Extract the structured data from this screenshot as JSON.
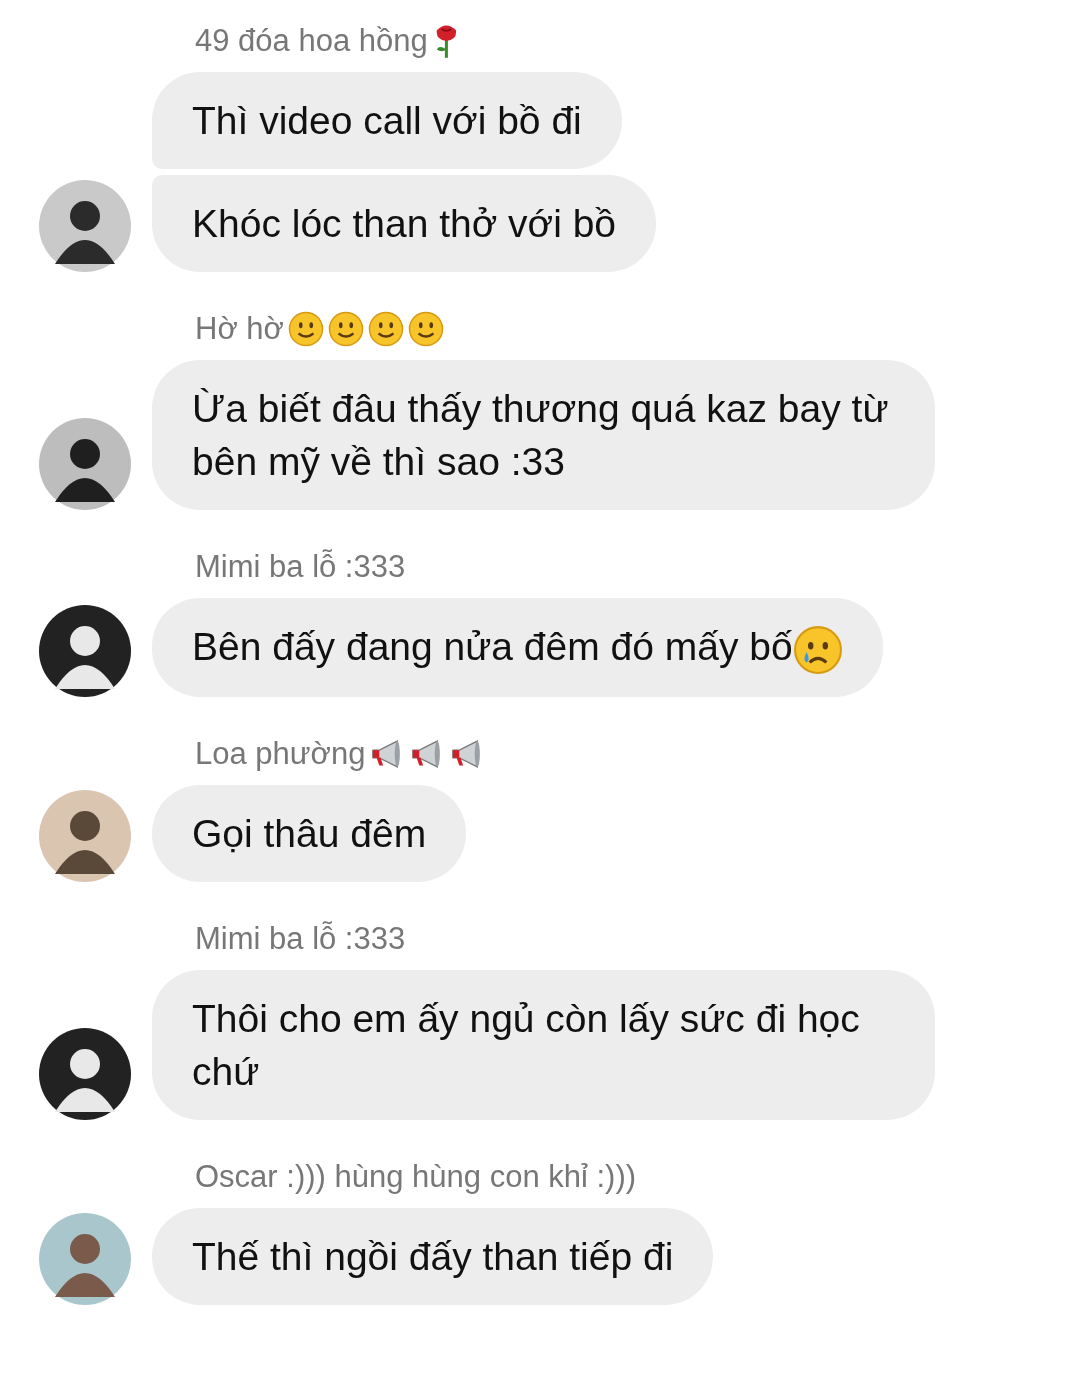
{
  "groups": [
    {
      "sender": {
        "name": "49 đóa hoa hồng",
        "emoji": [
          {
            "kind": "rose"
          }
        ]
      },
      "messages": [
        {
          "text": "Thì video call với bồ đi"
        },
        {
          "text": "Khóc lóc than thở với bồ"
        }
      ]
    },
    {
      "sender": {
        "name": "Hờ hờ",
        "emoji": [
          {
            "kind": "smile"
          },
          {
            "kind": "smile"
          },
          {
            "kind": "smile"
          },
          {
            "kind": "smile"
          }
        ]
      },
      "messages": [
        {
          "text": "Ừa biết đâu thấy thương quá kaz bay từ bên mỹ về thì sao :33"
        }
      ]
    },
    {
      "sender": {
        "name": "Mimi ba lỗ :333"
      },
      "messages": [
        {
          "text": "Bên đấy đang nửa đêm đó mấy bố",
          "emoji": [
            {
              "kind": "crying"
            }
          ]
        }
      ]
    },
    {
      "sender": {
        "name": "Loa phường",
        "emoji": [
          {
            "kind": "megaphone"
          },
          {
            "kind": "megaphone"
          },
          {
            "kind": "megaphone"
          }
        ]
      },
      "messages": [
        {
          "text": "Gọi thâu đêm"
        }
      ]
    },
    {
      "sender": {
        "name": "Mimi ba lỗ :333"
      },
      "messages": [
        {
          "text": "Thôi cho em ấy ngủ còn lấy sức đi học chứ"
        }
      ]
    },
    {
      "sender": {
        "name": "Oscar :))) hùng hùng con khỉ :)))"
      },
      "messages": [
        {
          "text": "Thế thì ngồi đấy than tiếp đi"
        }
      ]
    }
  ]
}
